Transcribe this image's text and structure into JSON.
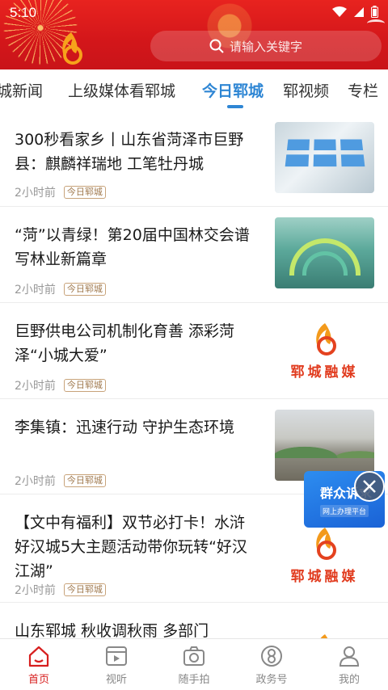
{
  "status_bar": {
    "time": "5:10"
  },
  "search": {
    "placeholder": "请输入关键字"
  },
  "tabs": [
    {
      "label": "城新闻",
      "active": false
    },
    {
      "label": "上级媒体看郓城",
      "active": false
    },
    {
      "label": "今日郓城",
      "active": true
    },
    {
      "label": "郓视频",
      "active": false
    },
    {
      "label": "专栏",
      "active": false
    }
  ],
  "feed": [
    {
      "title": "300秒看家乡丨山东省菏泽市巨野县：麒麟祥瑞地 工笔牡丹城",
      "time": "2小时前",
      "tag": "今日郓城",
      "thumb": "exhibition-screens"
    },
    {
      "title": "“菏”以青绿！第20届中国林交会谱写林业新篇章",
      "time": "2小时前",
      "tag": "今日郓城",
      "thumb": "expo-arches"
    },
    {
      "title": "巨野供电公司机制化育善 添彩菏泽“小城大爱”",
      "time": "2小时前",
      "tag": "今日郓城",
      "thumb": "yuncheng-media-logo"
    },
    {
      "title": "李集镇：迅速行动 守护生态环境",
      "time": "2小时前",
      "tag": "今日郓城",
      "thumb": "construction-site"
    },
    {
      "title": "【文中有福利】双节必打卡！水浒好汉城5大主题活动带你玩转“好汉江湖”",
      "time": "2小时前",
      "tag": "今日郓城",
      "thumb": "yuncheng-media-logo"
    },
    {
      "title": "山东郓城 秋收调秋雨 多部门",
      "thumb": "yuncheng-media-logo"
    }
  ],
  "logo_text": "郓城融媒",
  "float_ad": {
    "title": "群众诉求",
    "subtitle": "网上办理平台"
  },
  "bottom_nav": [
    {
      "label": "首页",
      "icon": "home-icon",
      "active": true
    },
    {
      "label": "视听",
      "icon": "video-icon",
      "active": false
    },
    {
      "label": "随手拍",
      "icon": "camera-icon",
      "active": false
    },
    {
      "label": "政务号",
      "icon": "government-icon",
      "active": false
    },
    {
      "label": "我的",
      "icon": "profile-icon",
      "active": false
    }
  ],
  "colors": {
    "header_red": "#d3161a",
    "active_tab": "#2e86d4",
    "nav_active": "#d71f1f",
    "tag_brown": "#a0794e"
  }
}
